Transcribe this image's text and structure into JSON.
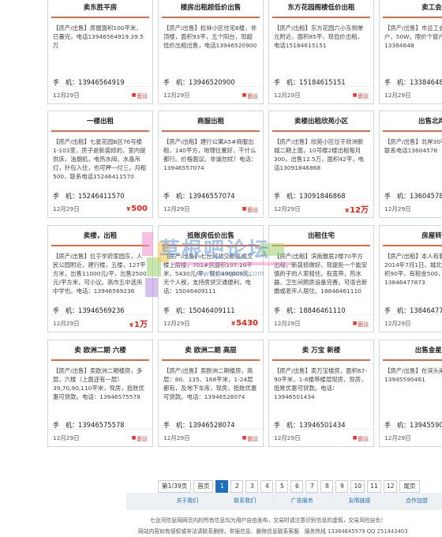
{
  "labels": {
    "phone_prefix": "手　机：",
    "report": "面议",
    "currency": "¥"
  },
  "cards": [
    {
      "title": "卖东胜平房",
      "desc": "【房产/出售】房屋面积100平米，已量完，电话13946564919.39.5万",
      "phone": "13946564919",
      "date": "12月29日",
      "price": ""
    },
    {
      "title": "楼房出租超低价出售",
      "desc": "【房产/出售】松林小区住宅6楼，非顶楼，面积93平，五个阳台，现超低价出租出售，电话13946520900",
      "phone": "13946520900",
      "date": "12月29日",
      "price": ""
    },
    {
      "title": "东方花园阁楼低价出租",
      "desc": "【房产/出租】东方花园六小东侧单元附近，面积85平，现低价出租，电话15184615151",
      "phone": "15184615151",
      "date": "12月29日",
      "price": ""
    },
    {
      "title": "卖工会",
      "desc": "【房产/出售】市总工会新楼未入户，50W。限价个窗户。13384648",
      "phone": "13384648",
      "date": "12月29日",
      "price": ""
    },
    {
      "title": "一楼出租",
      "desc": "【房产/出租】七星花园B区76号楼1-103室，房子是新装修的，室内提供床，油烟机，电热水阀，水晶吊灯，扑包入住，也可押一付三，月租500，联系电话15246411570",
      "phone": "15246411570",
      "date": "12月29日",
      "price": "500"
    },
    {
      "title": "商服出租",
      "desc": "【房产/出租】建行公寓A5#商服出租，140平方，地理位置好，干什么都行。价格面议。非诚勿扰！电话：13946557074",
      "phone": "13946557074",
      "date": "12月29日",
      "price": ""
    },
    {
      "title": "卖楼出租欣苑小区",
      "desc": "【房产/出售】欣苑小区位于欣洲新城二期上面，10号楼2楼出租每月300，出售12.5万，面积42平，电话13091846868",
      "phone": "13091846868",
      "date": "12月29日",
      "price": "12万"
    },
    {
      "title": "出售北岸",
      "desc": "【房产/出售】北岸30平方47.33，联系电话13604578",
      "phone": "13604578",
      "date": "12月29日",
      "price": ""
    },
    {
      "title": "卖楼，出租",
      "desc": "【房产/出售】位于学府家园东，人民公园附近，建行楼，五楼，127平方米，出售11000元/平，出售2500元/平方米，可小议。高市五中选央中学也。电话：13946569236",
      "phone": "13946569236",
      "date": "12月29日",
      "price": "1万"
    },
    {
      "title": "抵账房低价出售",
      "desc": "【房产/出售】七台河北交新区成交楼上层楼，701#房面积107.16平米，5430元/平，现价490000元，无个人税，支持房贷交通便利，电话：15046409111",
      "phone": "15046409111",
      "date": "12月29日",
      "price": "5430"
    },
    {
      "title": "出租住宅",
      "desc": "【房产/出租】滨南雅居2楼70平方出租，新装修做好，现提拒一个能安慎的子的人家租住。有宽带，热水器，卫生间照房设备完善。可适合新婚或老年人居住。18846461110",
      "phone": "18846461110",
      "date": "12月29日",
      "price": ""
    },
    {
      "title": "房屋转",
      "desc": "【房产/出租】本人有套房租，截止2014年7月1日，城北外出齐全，面积90平，有租金500，有意者电话：13846477873",
      "phone": "13846477873",
      "date": "12月29日",
      "price": ""
    },
    {
      "title": "卖 欧洲二期 六楼",
      "desc": "【房产/出售】卖欧洲二期楼房，多层，六楼（上面还有一层）39,70,90,110平米，现房，抵账优惠可贷款。电话：13946575578",
      "phone": "13946575578",
      "date": "12月29日",
      "price": ""
    },
    {
      "title": "卖 欧洲二期 高层",
      "desc": "【房产/出售】卖欧洲二期楼房，高层：80、135、168平米，1-24层都有，及地下车库，现房，抵账优惠可贷款。电话：13946528074",
      "phone": "13946528074",
      "date": "12月29日",
      "price": ""
    },
    {
      "title": "卖 万宝 新楼",
      "desc": "【房产/出售】卖万宝楼房，面积67-90平米，1-6楼带楼层现房，现房，抵账优惠可贷款。电话：13946501434",
      "phone": "13946501434",
      "date": "12月29日",
      "price": ""
    },
    {
      "title": "出售金星花",
      "desc": "【房产/出售】在滨头闸25平米13945590461",
      "phone": "13945590",
      "date": "12月29日",
      "price": ""
    }
  ],
  "pagination": {
    "info": "第1/39页",
    "first": "首页",
    "pages": [
      "1",
      "2",
      "3",
      "4",
      "5",
      "6",
      "7",
      "8",
      "9",
      "10",
      "11",
      "12"
    ],
    "last": "尾页",
    "current": "1"
  },
  "footer": {
    "links": [
      "关于我们",
      "联系我们",
      "广告服务",
      "友情链接",
      "合作加盟"
    ],
    "notice": "七台河信息网网页内的所有信息均为用户自由发布，交易时请注意识别信息的虚假，交易风险自负！",
    "contact": "网站内容如有侵权或非法请联系删除，举报信息、删除信息联系客服　服务热线 13384645979 QQ 251443403"
  },
  "watermark": {
    "text": "草根吧论坛",
    "url": "www.caogen8.com"
  },
  "colors": {
    "accent": "#e56a3c",
    "price": "#e21111",
    "link": "#1f6fbf",
    "pager_active": "#1f6fbf"
  }
}
